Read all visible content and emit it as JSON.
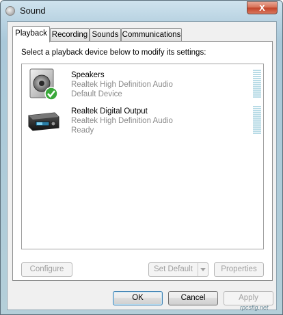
{
  "window": {
    "title": "Sound",
    "close_glyph": "X"
  },
  "tabs": [
    {
      "label": "Playback",
      "active": true
    },
    {
      "label": "Recording",
      "active": false
    },
    {
      "label": "Sounds",
      "active": false
    },
    {
      "label": "Communications",
      "active": false
    }
  ],
  "playback": {
    "instruction": "Select a playback device below to modify its settings:",
    "devices": [
      {
        "name": "Speakers",
        "description": "Realtek High Definition Audio",
        "status": "Default Device",
        "icon": "speakers-icon",
        "default": true
      },
      {
        "name": "Realtek Digital Output",
        "description": "Realtek High Definition Audio",
        "status": "Ready",
        "icon": "digital-output-icon",
        "default": false
      }
    ],
    "buttons": {
      "configure": "Configure",
      "set_default": "Set Default",
      "properties": "Properties"
    }
  },
  "dialog_buttons": {
    "ok": "OK",
    "cancel": "Cancel",
    "apply": "Apply"
  },
  "watermark": "rpcsfig.net"
}
